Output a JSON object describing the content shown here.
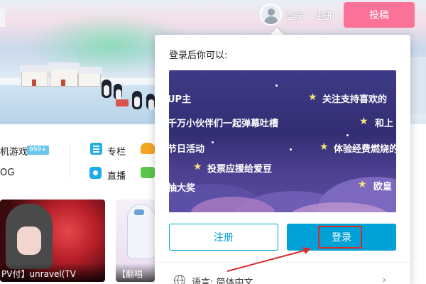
{
  "header": {
    "login": "登录",
    "register": "注册",
    "upload": "投稿"
  },
  "categories": {
    "games": "机游戏",
    "games_badge": "999+",
    "vlog": "OG",
    "column": "专栏",
    "live": "直播"
  },
  "cards": [
    {
      "title": "PV付】unravel(TV"
    },
    {
      "title": "【翻唱"
    }
  ],
  "popup": {
    "heading": "登录后你可以:",
    "promo_lines": [
      "UP主",
      "关注支持喜欢的",
      "千万小伙伴们一起弹幕吐槽",
      "和上",
      "节日活动",
      "体验经费燃烧的",
      "投票应援给爱豆",
      "欧皇",
      "抽大奖"
    ],
    "register_button": "注册",
    "login_button": "登录",
    "language": "语言: 简体中文"
  },
  "colors": {
    "upload_pink": "#fb7299",
    "bili_blue": "#00a1d6",
    "highlight_red": "#d92b2b"
  }
}
